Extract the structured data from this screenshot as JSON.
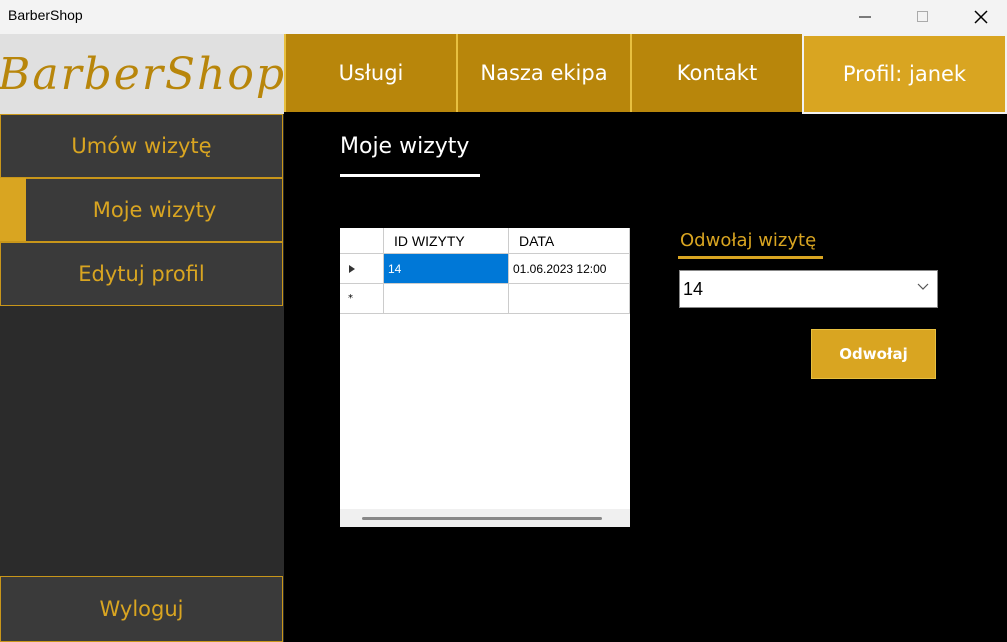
{
  "window": {
    "title": "BarberShop"
  },
  "logo": {
    "text": "BarberShop"
  },
  "topnav": {
    "uslugi": "Usługi",
    "ekipa": "Nasza ekipa",
    "kontakt": "Kontakt",
    "profil": "Profil: janek"
  },
  "sidebar": {
    "umow": "Umów wizytę",
    "moje": "Moje wizyty",
    "edytuj": "Edytuj profil",
    "wyloguj": "Wyloguj"
  },
  "main": {
    "title": "Moje wizyty",
    "grid": {
      "columns": [
        "ID WIZYTY",
        "DATA"
      ],
      "rows": [
        {
          "id": "14",
          "data": "01.06.2023 12:00"
        }
      ],
      "new_row_marker": "*"
    },
    "cancel": {
      "label": "Odwołaj wizytę",
      "selected": "14",
      "button": "Odwołaj"
    }
  },
  "colors": {
    "accent": "#d9a521",
    "nav": "#b8860b",
    "sidebar": "#3a3a3a",
    "selection": "#0078d7"
  }
}
